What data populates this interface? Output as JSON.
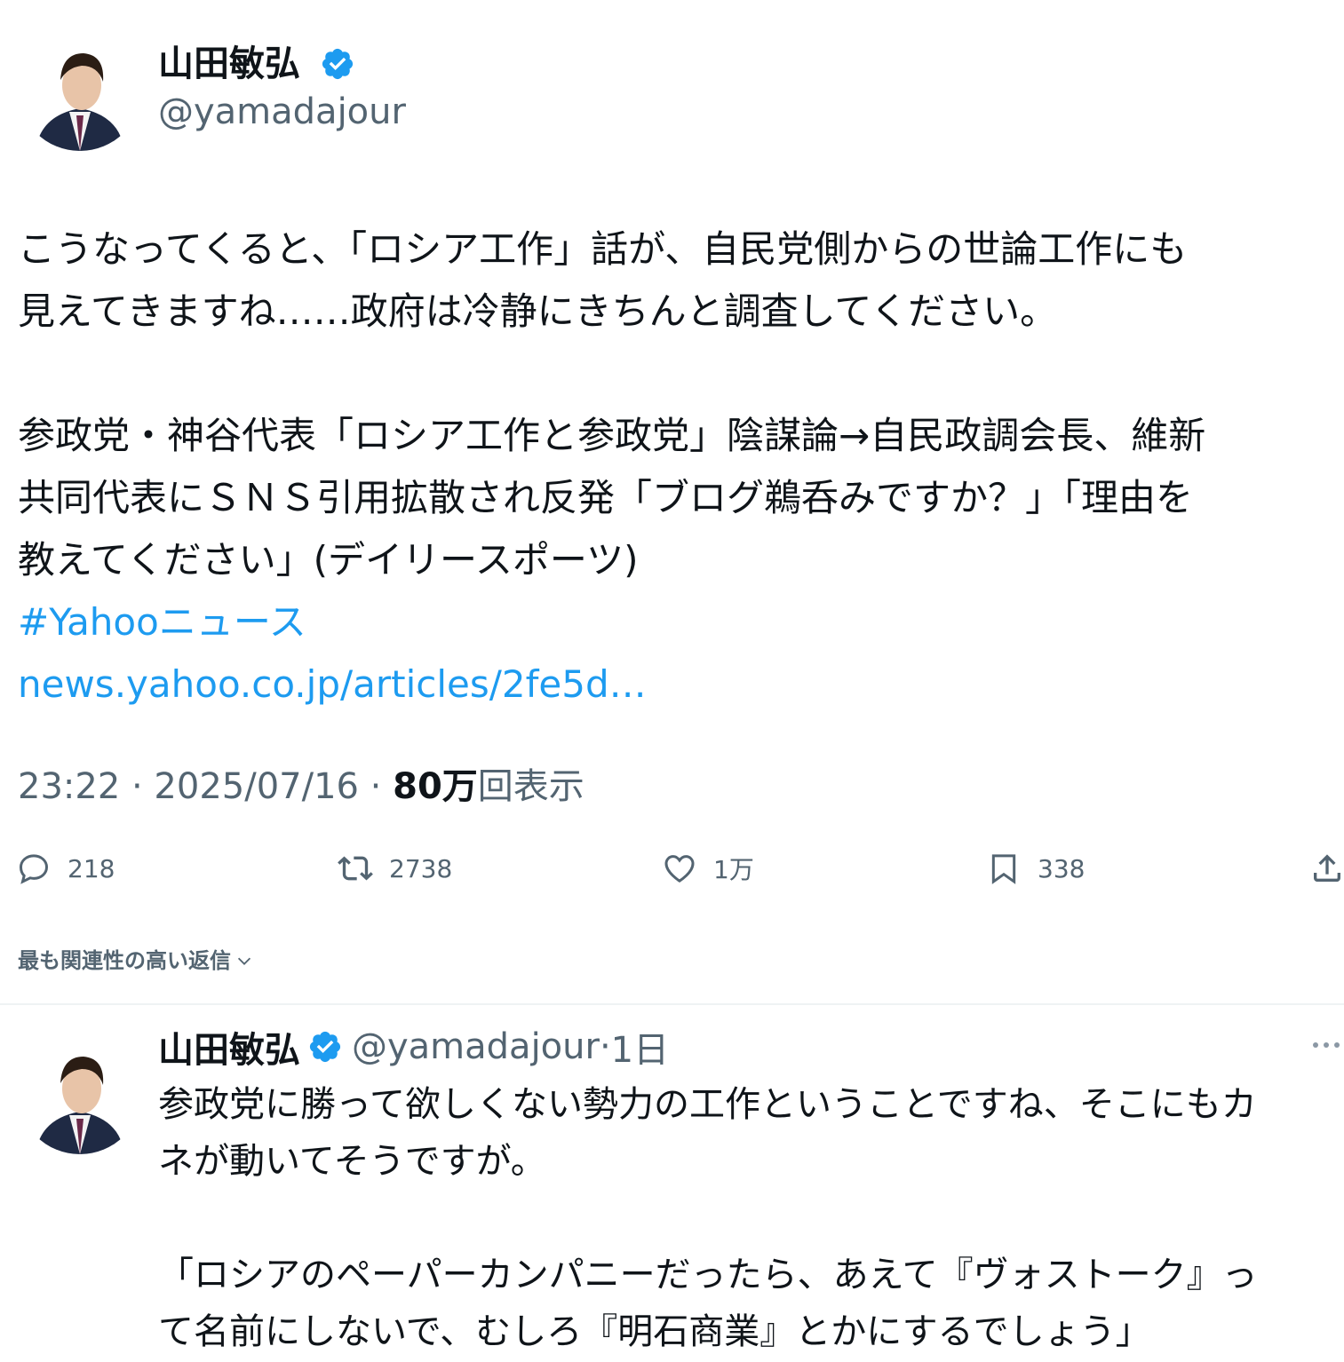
{
  "post": {
    "author_name": "山田敏弘",
    "author_handle": "@yamadajour",
    "text_line1": "こうなってくると、「ロシア工作」話が、自民党側からの世論工作にも\n見えてきますね……政府は冷静にきちんと調査してください。",
    "text_line2": "参政党・神谷代表「ロシア工作と参政党」陰謀論→自民政調会長、維新\n共同代表にＳＮＳ引用拡散され反発「ブログ鵜呑みですか？」「理由を\n教えてください」(デイリースポーツ)",
    "hashtag": "#Yahooニュース",
    "link": "news.yahoo.co.jp/articles/2fe5d…",
    "time": "23:22 · 2025/07/16 · ",
    "views_count": "80万",
    "views_label": "回表示"
  },
  "actions": {
    "replies": "218",
    "reposts": "2738",
    "likes": "1万",
    "bookmarks": "338"
  },
  "replies_sort_label": "最も関連性の高い返信",
  "reply": {
    "author_name": "山田敏弘",
    "author_handle": "@yamadajour",
    "separator": " · ",
    "time": "1日",
    "text_line1": "参政党に勝って欲しくない勢力の工作ということですね、そこにもカ\nネが動いてそうですが。",
    "text_line2": "「ロシアのペーパーカンパニーだったら、あえて『ヴォストーク』っ\nて名前にしないで、むしろ『明石商業』とかにするでしょう」"
  },
  "colors": {
    "link": "#1d9bf0",
    "verified": "#1d9bf0",
    "secondary_text": "#536471",
    "primary_text": "#0f1419"
  }
}
